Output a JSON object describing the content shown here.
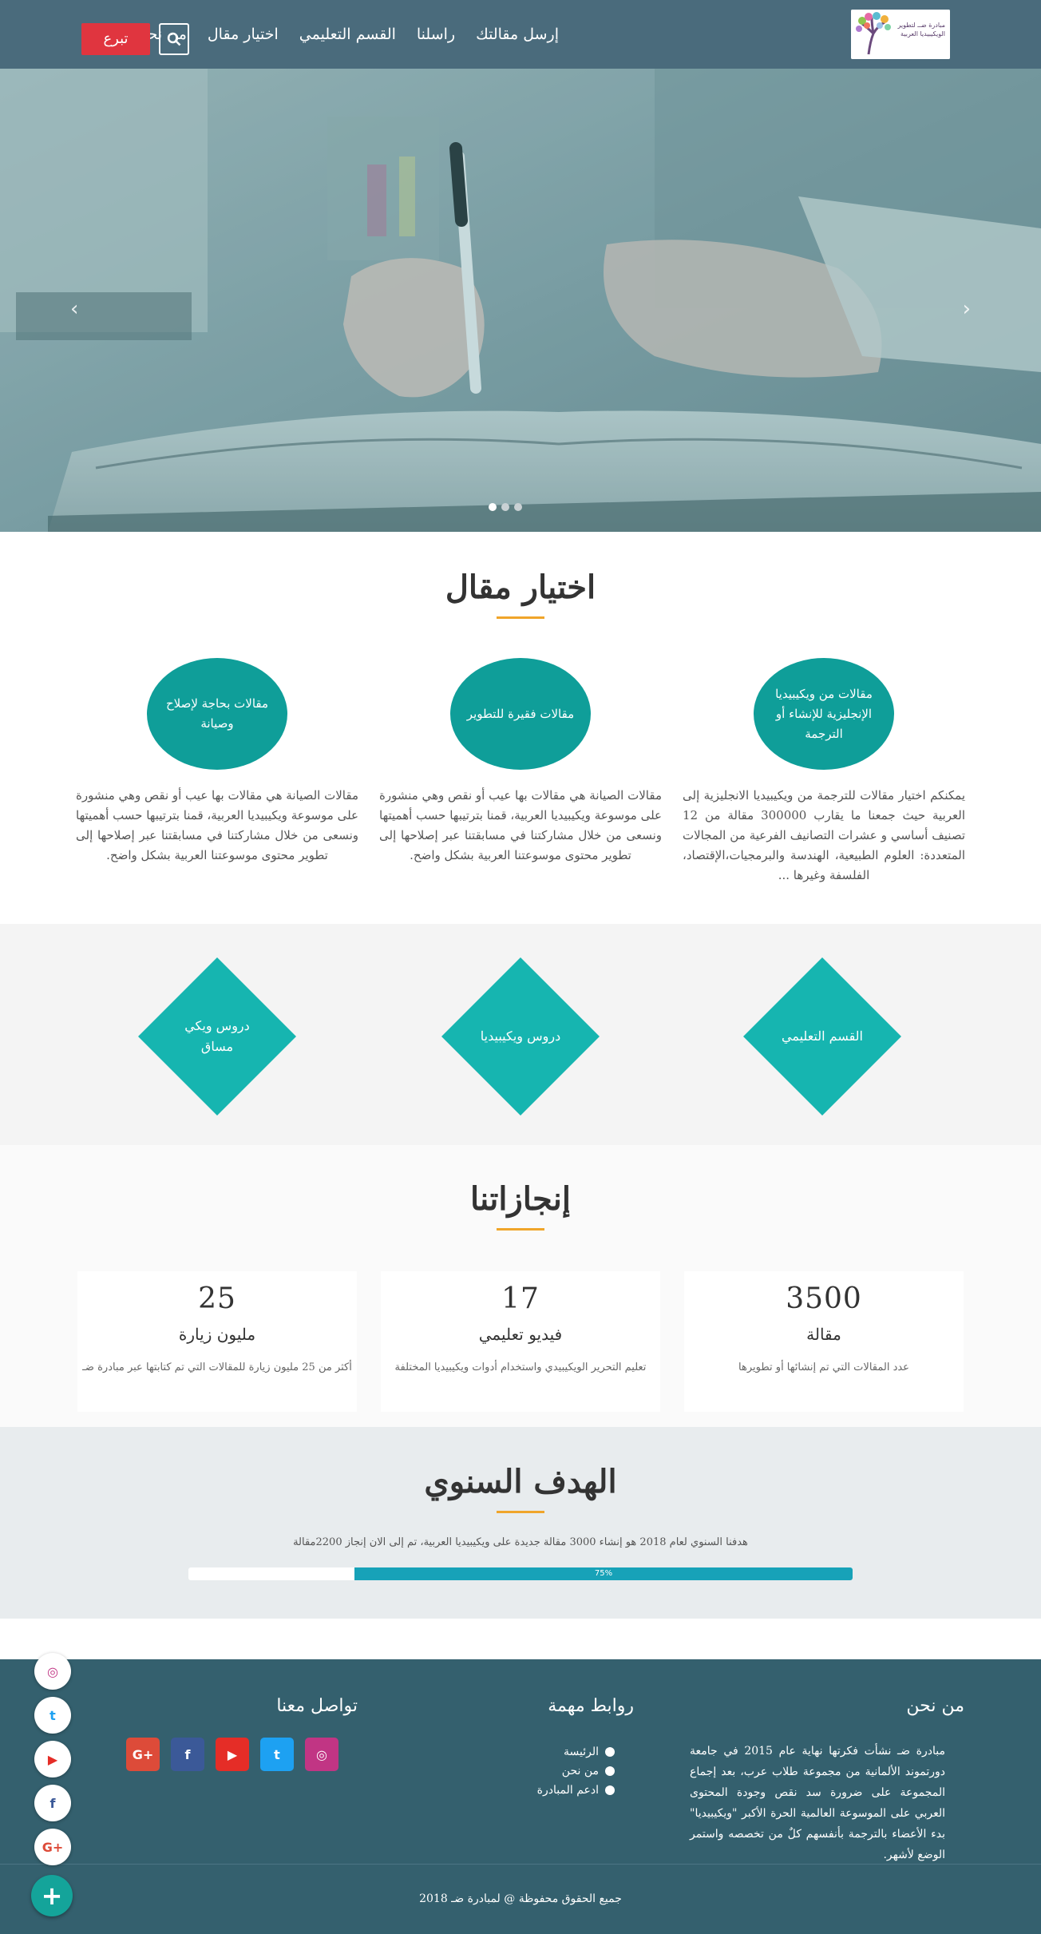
{
  "header": {
    "logo_text": "مبادرة ضــ لتطوير الويكيبيديا العربية",
    "nav": [
      "من نحن",
      "اختيار مقال",
      "القسم التعليمي",
      "راسلنا",
      "إرسل مقالتك"
    ],
    "donate_label": "تبرع",
    "search_icon": "search-icon"
  },
  "hero": {
    "slides": 3,
    "active_slide": 1
  },
  "article_selection": {
    "title": "اختيار مقال",
    "items": [
      {
        "circle": "مقالات من ويكيبيديا الإنجليزية للإنشاء أو الترجمة",
        "text": "يمكنكم اختيار مقالات للترجمة من ويكيبيديا الانجليزية إلى العربية حيث جمعنا ما يقارب 300000 مقالة من 12 تصنيف أساسي و عشرات التصانيف الفرعية من المجالات المتعددة: العلوم الطبيعية، الهندسة والبرمجيات،الإقتصاد، الفلسفة وغيرها ..."
      },
      {
        "circle": "مقالات فقيرة للتطوير",
        "text": "مقالات الصيانة هي مقالات بها عيب أو نقص وهي منشورة على موسوعة ويكيبيديا العربية، قمنا بترتيبها حسب أهميتها ونسعى من خلال مشاركتنا في مسابقتنا عبر إصلاحها إلى تطوير محتوى موسوعتنا العربية بشكل واضح."
      },
      {
        "circle": "مقالات بحاجة لإصلاح وصيانة",
        "text": "مقالات الصيانة هي مقالات بها عيب أو نقص وهي منشورة على موسوعة ويكيبيديا العربية، قمنا بترتيبها حسب أهميتها ونسعى من خلال مشاركتنا في مسابقتنا عبر إصلاحها إلى تطوير محتوى موسوعتنا العربية بشكل واضح."
      }
    ]
  },
  "sections": [
    "القسم التعليمي",
    "دروس ويكيبيديا",
    "دروس ويكي مساق"
  ],
  "achievements": {
    "title": "إنجازاتنا",
    "cards": [
      {
        "number": "3500",
        "label": "مقالة",
        "desc": "عدد المقالات التي تم إنشائها أو تطويرها"
      },
      {
        "number": "17",
        "label": "فيديو تعليمي",
        "desc": "تعليم التحرير الويكيبيدي واستخدام أدوات ويكيبيديا المختلفة"
      },
      {
        "number": "25",
        "label": "مليون زيارة",
        "desc": "أكثر من 25 مليون زيارة للمقالات التي تم كتابتها عبر مبادرة ضـ"
      }
    ]
  },
  "goal": {
    "title": "الهدف السنوي",
    "text": "هدفنا السنوي لعام 2018 هو إنشاء 3000 مقالة جديدة على ويكيبيديا العربية، تم إلى الان إنجاز 2200مقالة",
    "progress_label": "75%",
    "progress": 75
  },
  "footer": {
    "about_title": "من نحن",
    "about_text": "مبادرة ضـ نشأت فكرتها نهاية عام 2015 في جامعة دورتموند الألمانية من مجموعة طلاب عرب، بعد إجماع المجموعة على ضرورة سد نقص وجودة المحتوى العربي على الموسوعة العالمية الحرة الأكبر \"ويكيبيديا\" بدء الأعضاء بالترجمة بأنفسهم كلٌ من تخصصه واستمر الوضع لأشهر.",
    "links_title": "روابط مهمة",
    "links": [
      "الرئيسة",
      "من نحن",
      "ادعم المبادرة"
    ],
    "contact_title": "تواصل معنا",
    "socials": [
      {
        "icon": "instagram-icon",
        "glyph": "◎",
        "color": "#c13584"
      },
      {
        "icon": "twitter-icon",
        "glyph": "t",
        "color": "#1da1f2"
      },
      {
        "icon": "youtube-icon",
        "glyph": "▶",
        "color": "#e52d27"
      },
      {
        "icon": "facebook-icon",
        "glyph": "f",
        "color": "#3b5998"
      },
      {
        "icon": "google-plus-icon",
        "glyph": "G+",
        "color": "#dd4b39"
      }
    ],
    "copyright": "جميع الحقوق محفوظة @ لمبادرة ضـ 2018"
  },
  "floating": {
    "fab_glyph": "+"
  }
}
